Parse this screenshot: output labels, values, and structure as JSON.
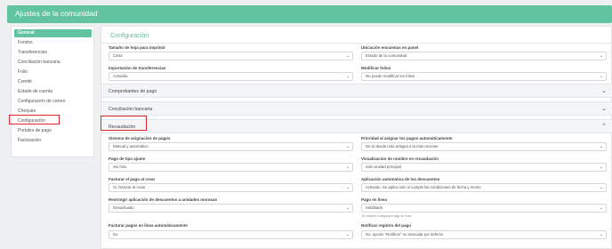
{
  "header": {
    "title": "Ajustes de la comunidad"
  },
  "sidebar": {
    "items": [
      {
        "label": "General"
      },
      {
        "label": "Fondos"
      },
      {
        "label": "Transferencias"
      },
      {
        "label": "Conciliación bancaria"
      },
      {
        "label": "Folio"
      },
      {
        "label": "Comité"
      },
      {
        "label": "Estado de cuenta"
      },
      {
        "label": "Configuración de correo"
      },
      {
        "label": "Cheques"
      },
      {
        "label": "Configuración"
      },
      {
        "label": "Portales de pago"
      },
      {
        "label": "Facturación"
      }
    ],
    "active_index": 0
  },
  "config": {
    "title": "Configuración",
    "fields": [
      {
        "label": "Tamaño de hoja para imprimir",
        "value": "Carta"
      },
      {
        "label": "Ubicación encuestas en panel",
        "value": "Estado de la comunidad"
      },
      {
        "label": "Importación de transferencias",
        "value": "Activado"
      },
      {
        "label": "Modificar folios",
        "value": "No puede modificar los folios"
      }
    ]
  },
  "sections": {
    "comprobantes": "Comprobantes de pago",
    "conciliacion": "Conciliación bancaria",
    "recaudacion": "Recaudación"
  },
  "recaudacion": {
    "fields": [
      {
        "label": "Sistema de asignación de pagos",
        "value": "Manual y automático"
      },
      {
        "label": "Prioridad al asignar los pagos automáticamente",
        "value": "De la deuda más antigua a la más reciente"
      },
      {
        "label": "Pago de tipo ajuste",
        "value": "Sin folio"
      },
      {
        "label": "Visualización de nombre en recaudación",
        "value": "Solo unidad principal"
      },
      {
        "label": "Facturar el pago al crear",
        "value": "Si, facturar al crear"
      },
      {
        "label": "Aplicación automática de los descuentos",
        "value": "Activado. Se aplica solo si cumple las condiciones de fecha y monto"
      },
      {
        "label": "Restringir aplicación de descuentos a unidades morosas",
        "value": "Desactivado"
      },
      {
        "label": "Pago en línea",
        "value": "Habilitado",
        "note": "Se requiere configurar el pago en línea"
      },
      {
        "label": "Facturar pagos en línea automáticamente",
        "value": "No"
      },
      {
        "label": "Notificar registro del pago",
        "value": "No, opción \"Notificar\" no marcada por defecto"
      }
    ]
  },
  "icons": {
    "dropdown": "chevron-down-icon",
    "accordion": "chevron-down-icon"
  },
  "colors": {
    "accent": "#62c49e",
    "highlight": "#e0262d"
  }
}
